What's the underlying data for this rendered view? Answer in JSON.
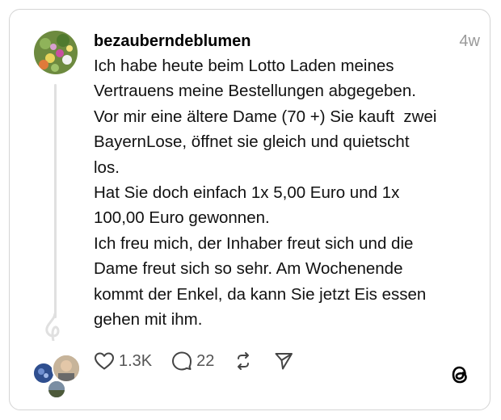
{
  "post": {
    "username": "bezauberndeblumen",
    "timestamp": "4w",
    "lines": [
      "Ich habe heute beim Lotto Laden meines",
      "Vertrauens meine Bestellungen abgegeben.",
      "Vor mir eine ältere Dame (70 +) Sie kauft  zwei",
      "BayernLose, öffnet sie gleich und quietscht",
      "los.",
      "Hat Sie doch einfach 1x 5,00 Euro und 1x",
      "100,00 Euro gewonnen.",
      "Ich freu mich, der Inhaber freut sich und die",
      "Dame freut sich so sehr. Am Wochenende",
      "kommt der Enkel, da kann Sie jetzt Eis essen",
      "gehen mit ihm."
    ]
  },
  "actions": {
    "likes": "1.3K",
    "replies": "22"
  },
  "icons": {
    "like": "heart-icon",
    "reply": "comment-bubble-icon",
    "repost": "repost-icon",
    "share": "send-icon",
    "brand": "threads-logo-icon"
  },
  "colors": {
    "border": "#d4d4d4",
    "timestamp": "#9a9a9a",
    "icon": "#444444"
  }
}
